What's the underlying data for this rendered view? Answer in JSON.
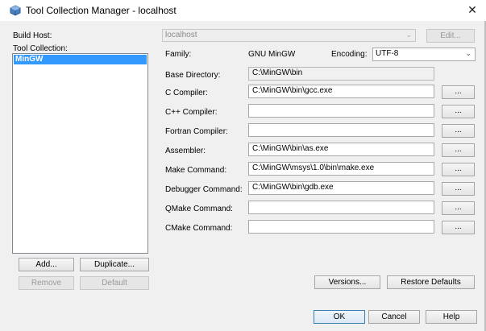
{
  "window": {
    "title": "Tool Collection Manager - localhost",
    "close_glyph": "✕"
  },
  "build_host": {
    "label": "Build Host:",
    "value": "localhost",
    "edit_label": "Edit..."
  },
  "tool_collection": {
    "label": "Tool Collection:",
    "items": [
      "MinGW"
    ]
  },
  "family": {
    "label": "Family:",
    "value": "GNU MinGW"
  },
  "encoding": {
    "label": "Encoding:",
    "value": "UTF-8"
  },
  "fields": {
    "base_directory": {
      "label": "Base Directory:",
      "value": "C:\\MinGW\\bin"
    },
    "c_compiler": {
      "label": "C Compiler:",
      "value": "C:\\MinGW\\bin\\gcc.exe"
    },
    "cpp_compiler": {
      "label": "C++ Compiler:",
      "value": ""
    },
    "fortran_compiler": {
      "label": "Fortran Compiler:",
      "value": ""
    },
    "assembler": {
      "label": "Assembler:",
      "value": "C:\\MinGW\\bin\\as.exe"
    },
    "make_command": {
      "label": "Make Command:",
      "value": "C:\\MinGW\\msys\\1.0\\bin\\make.exe"
    },
    "debugger_command": {
      "label": "Debugger Command:",
      "value": "C:\\MinGW\\bin\\gdb.exe"
    },
    "qmake_command": {
      "label": "QMake Command:",
      "value": ""
    },
    "cmake_command": {
      "label": "CMake Command:",
      "value": ""
    }
  },
  "browse_label": "...",
  "buttons": {
    "add": "Add...",
    "duplicate": "Duplicate...",
    "remove": "Remove",
    "default": "Default",
    "versions": "Versions...",
    "restore_defaults": "Restore Defaults",
    "ok": "OK",
    "cancel": "Cancel",
    "help": "Help"
  },
  "colors": {
    "selection": "#3399ff",
    "focus_border": "#3c7fb1"
  },
  "icons": {
    "app": "cube-icon",
    "dropdown": "chevron-down-icon"
  }
}
